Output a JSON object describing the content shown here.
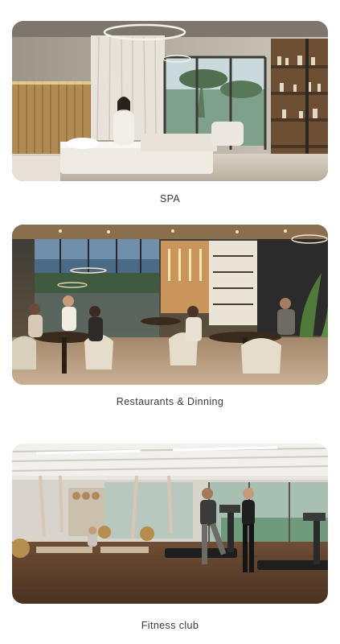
{
  "amenities": [
    {
      "caption": "SPA",
      "scene": "spa-room"
    },
    {
      "caption": "Restaurants & Dinning",
      "scene": "restaurant-interior"
    },
    {
      "caption": "Fitness club",
      "scene": "gym-interior"
    }
  ],
  "colors": {
    "background": "#ffffff",
    "caption_text": "#3a3a3a"
  }
}
